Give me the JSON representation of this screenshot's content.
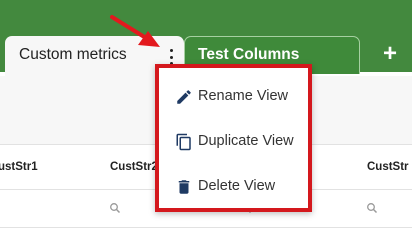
{
  "tabs": {
    "active_label": "Custom metrics",
    "inactive_label": "Test Columns",
    "add_label": "+"
  },
  "grid": {
    "columns": [
      "ustStr1",
      "CustStr2",
      "CustStr"
    ]
  },
  "context_menu": {
    "items": [
      {
        "label": "Rename View",
        "icon": "pencil-icon"
      },
      {
        "label": "Duplicate View",
        "icon": "copy-icon"
      },
      {
        "label": "Delete View",
        "icon": "trash-icon"
      }
    ]
  },
  "colors": {
    "tab_bar": "#43893e",
    "highlight": "#d4181d",
    "icon": "#1f3a63"
  }
}
